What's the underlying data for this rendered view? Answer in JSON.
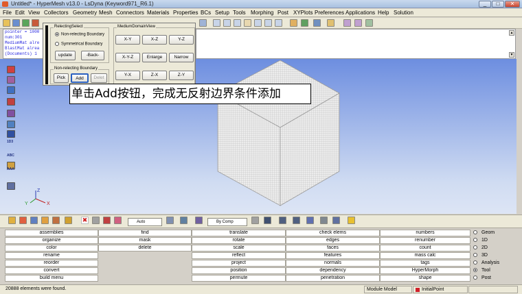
{
  "window": {
    "title": "Untitled* - HyperMesh v13.0 - LsDyna (Keyword971_R6.1)",
    "min": "_",
    "max": "□",
    "close": "✕"
  },
  "menu": [
    "File",
    "Edit",
    "View",
    "Collectors",
    "Geometry",
    "Mesh",
    "Connectors",
    "Materials",
    "Properties",
    "BCs",
    "Setup",
    "Tools",
    "Morphing",
    "Post",
    "XYPlots",
    "Preferences",
    "Applications",
    "Help",
    "Solution"
  ],
  "command_window": {
    "lines": [
      "pointer = 1000",
      "num:301",
      "MediumMat alre",
      "BlastMat alrea",
      "(Documents) 1"
    ]
  },
  "dialog": {
    "relecting_select": {
      "title": "RelectingSelect",
      "opt1": "Non-relecting Boundary",
      "opt2": "Symmetrical  Boundary",
      "update": "update",
      "back": "-Back-"
    },
    "non_reflecting": {
      "title": "Non-relecting Boundary",
      "pick": "Pick",
      "add": "Add",
      "delete": "Delet"
    },
    "medium_view": {
      "title": "MediumDomainView",
      "buttons": [
        "X-Y",
        "X-Z",
        "Y-Z",
        "X-Y-Z",
        "Enlarge",
        "Narrow",
        "Y-X",
        "Z-X",
        "Z-Y"
      ]
    }
  },
  "caption": "单击Add按钮，完成无反射边界条件添加",
  "axis": {
    "z": "Z",
    "y": "Y",
    "x": "X"
  },
  "left_icons": {
    "i1": "1D3",
    "i2": "ABC",
    "i3": "AAA"
  },
  "bottom_toolbar": {
    "auto": "Auto",
    "by_comp": "By Comp"
  },
  "panel": {
    "col1": [
      "assemblies",
      "organize",
      "color",
      "rename",
      "reorder",
      "convert",
      "build menu"
    ],
    "col2": [
      "find",
      "mask",
      "delete"
    ],
    "col3": [
      "translate",
      "rotate",
      "scale",
      "reflect",
      "project",
      "position",
      "permute"
    ],
    "col4": [
      "check elems",
      "edges",
      "faces",
      "features",
      "normals",
      "dependency",
      "penetration"
    ],
    "col5": [
      "numbers",
      "renumber",
      "count",
      "mass calc",
      "tags",
      "HyperMorph",
      "shape"
    ],
    "radios": [
      "Geom",
      "1D",
      "2D",
      "3D",
      "Analysis",
      "Tool",
      "Post"
    ],
    "selected_radio": "Tool"
  },
  "status": {
    "message": "20888 elements were found.",
    "module": "Module Model",
    "model": "InitialPoint"
  },
  "colors": {
    "viewport_top": "#6d8ee0",
    "viewport_bottom": "#dde5f5",
    "cube_face": "#e8e8e8",
    "status_red": "#d0202a"
  }
}
